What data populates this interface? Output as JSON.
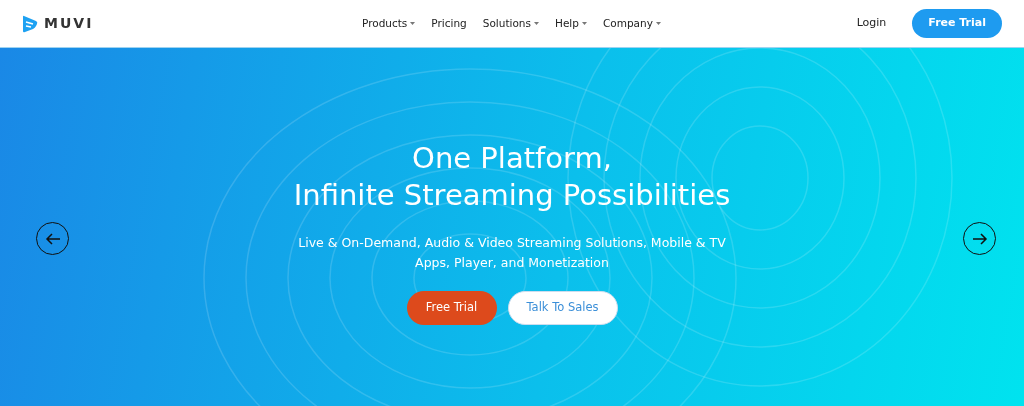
{
  "header": {
    "logo": "MUVI",
    "nav": [
      {
        "label": "Products",
        "has_menu": true
      },
      {
        "label": "Pricing",
        "has_menu": false
      },
      {
        "label": "Solutions",
        "has_menu": true
      },
      {
        "label": "Help",
        "has_menu": true
      },
      {
        "label": "Company",
        "has_menu": true
      }
    ],
    "login": "Login",
    "cta": "Free Trial"
  },
  "hero": {
    "title_lines": [
      "One Platform,",
      "Infinite Streaming Possibilities"
    ],
    "subtitle": "Live & On-Demand, Audio & Video Streaming Solutions, Mobile & TV Apps, Player, and Monetization",
    "primary_button": "Free Trial",
    "secondary_button": "Talk To Sales"
  }
}
